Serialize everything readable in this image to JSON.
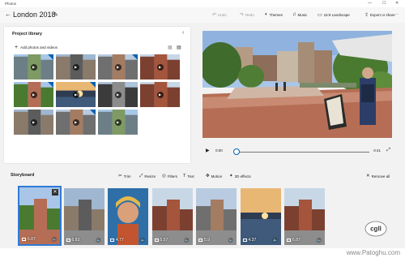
{
  "window": {
    "app_name": "Photos",
    "minimize": "—",
    "maximize": "☐",
    "close": "✕"
  },
  "header": {
    "back_glyph": "←",
    "title": "London 2018",
    "tools": [
      {
        "label": "Undo",
        "icon": "undo-icon",
        "glyph": "↶",
        "enabled": false
      },
      {
        "label": "Redo",
        "icon": "redo-icon",
        "glyph": "↷",
        "enabled": false
      },
      {
        "label": "Themes",
        "icon": "themes-icon",
        "glyph": "◐",
        "enabled": true
      },
      {
        "label": "Music",
        "icon": "music-icon",
        "glyph": "♫",
        "enabled": true
      },
      {
        "label": "16:9 Landscape",
        "icon": "aspect-ratio-icon",
        "glyph": "▭",
        "enabled": true
      },
      {
        "label": "Export or share",
        "icon": "export-icon",
        "glyph": "⇪",
        "enabled": true
      },
      {
        "label": "···",
        "icon": "more-icon",
        "glyph": "",
        "enabled": true
      }
    ]
  },
  "library": {
    "title": "Project library",
    "add_label": "Add photos and videos",
    "collapse_glyph": "‹",
    "thumbs": [
      {
        "scene": "sky",
        "video": true,
        "corner": true
      },
      {
        "scene": "street",
        "video": true,
        "corner": false
      },
      {
        "scene": "buildings",
        "video": true,
        "corner": true
      },
      {
        "scene": "brick",
        "video": true,
        "corner": false
      },
      {
        "scene": "plaza",
        "video": true,
        "corner": true
      },
      {
        "scene": "river",
        "video": true,
        "corner": true
      },
      {
        "scene": "tower",
        "video": true,
        "corner": false
      },
      {
        "scene": "brick",
        "video": true,
        "corner": false
      },
      {
        "scene": "street",
        "video": true,
        "corner": false
      },
      {
        "scene": "buildings",
        "video": true,
        "corner": true
      },
      {
        "scene": "sky",
        "video": true,
        "corner": false
      }
    ]
  },
  "player": {
    "current": "0:00",
    "end": "0:41",
    "progress": 0
  },
  "storyboard": {
    "title": "Storyboard",
    "tools": [
      {
        "label": "Trim",
        "icon": "trim-icon",
        "glyph": "✂"
      },
      {
        "label": "Resize",
        "icon": "resize-icon",
        "glyph": "⤢"
      },
      {
        "label": "Filters",
        "icon": "filters-icon",
        "glyph": "◎"
      },
      {
        "label": "Text",
        "icon": "text-icon",
        "glyph": "T"
      },
      {
        "label": "Motion",
        "icon": "motion-icon",
        "glyph": "✥"
      },
      {
        "label": "3D effects",
        "icon": "3d-effects-icon",
        "glyph": "✦"
      }
    ],
    "remove_label": "Remove all",
    "cards": [
      {
        "duration": "6.87",
        "scene": "plaza",
        "selected": true
      },
      {
        "duration": "6.83",
        "scene": "street",
        "selected": false
      },
      {
        "duration": "4.77",
        "scene": "child",
        "selected": false
      },
      {
        "duration": "5.57",
        "scene": "brick",
        "selected": false
      },
      {
        "duration": "5.9",
        "scene": "buildings",
        "selected": false
      },
      {
        "duration": "4.37",
        "scene": "river",
        "selected": false
      },
      {
        "duration": "6.87",
        "scene": "brick",
        "selected": false
      }
    ]
  },
  "watermark": {
    "text": "www.Patoghu.com",
    "logo_text": "cgll"
  }
}
